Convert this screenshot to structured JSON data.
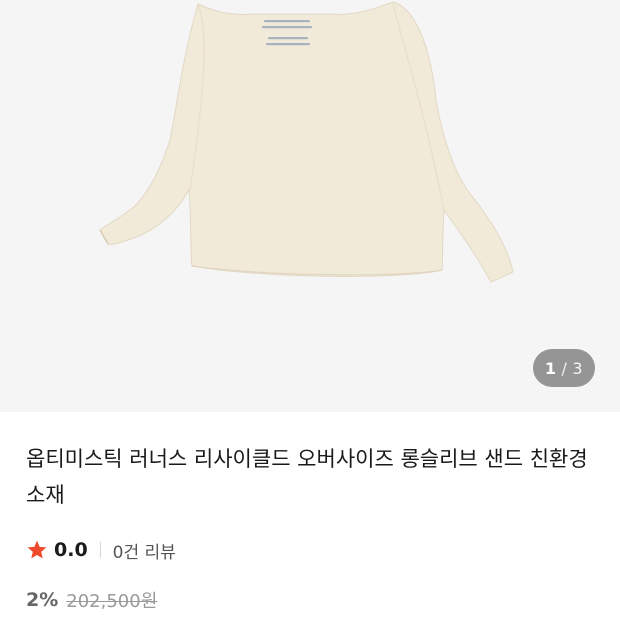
{
  "colors": {
    "gallery_bg": "#f5f5f5",
    "garment": "#f2ead9",
    "star": "#f04a2c",
    "pager_bg": "#8a8a8a"
  },
  "gallery": {
    "image_alt": "product-photo-longsleeve-tshirt",
    "pager": {
      "current": "1",
      "separator": "/",
      "total": "3"
    }
  },
  "product": {
    "title": "옵티미스틱 러너스 리사이클드 오버사이즈 롱슬리브 샌드 친환경 소재",
    "rating": {
      "score": "0.0",
      "review_count": "0건 리뷰"
    },
    "price": {
      "discount": "2%",
      "original": "202,500원"
    }
  }
}
